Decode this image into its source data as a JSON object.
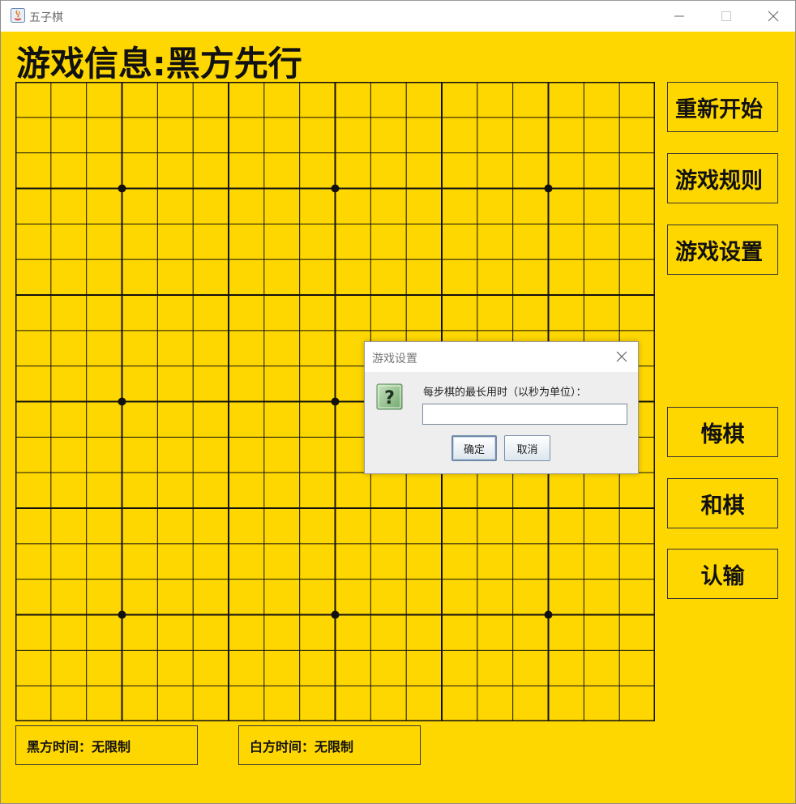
{
  "window": {
    "title": "五子棋"
  },
  "game_info": "游戏信息:黑方先行",
  "board": {
    "lines": 19,
    "star_points": [
      [
        3,
        3
      ],
      [
        3,
        9
      ],
      [
        3,
        15
      ],
      [
        9,
        3
      ],
      [
        9,
        9
      ],
      [
        9,
        15
      ],
      [
        15,
        3
      ],
      [
        15,
        9
      ],
      [
        15,
        15
      ]
    ],
    "line_color": "#111111",
    "background": "#ffd700"
  },
  "side_buttons": {
    "restart": "重新开始",
    "rules": "游戏规则",
    "settings": "游戏设置",
    "undo": "悔棋",
    "draw": "和棋",
    "resign": "认输"
  },
  "timers": {
    "black": "黑方时间：无限制",
    "white": "白方时间：无限制"
  },
  "dialog": {
    "title": "游戏设置",
    "message": "每步棋的最长用时（以秒为单位）：",
    "input_value": "",
    "ok_label": "确定",
    "cancel_label": "取消",
    "icon": "question-icon"
  },
  "colors": {
    "background": "#ffd700",
    "dialog_bg": "#eeeeee"
  }
}
